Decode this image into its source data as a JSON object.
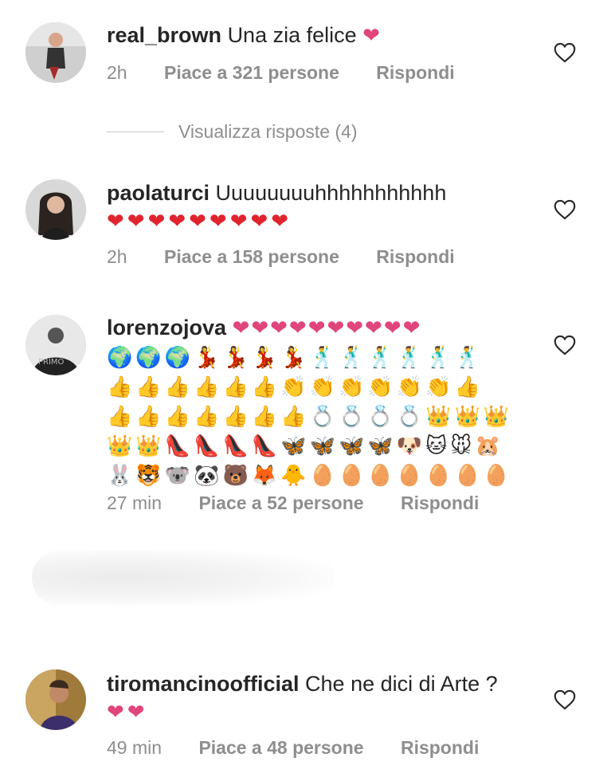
{
  "comments": [
    {
      "username": "real_brown",
      "text": "Una zia felice",
      "inline_emoji": "❤",
      "time": "2h",
      "likes": "Piace a 321 persone",
      "reply": "Rispondi"
    },
    {
      "username": "paolaturci",
      "text": "Uuuuuuuuhhhhhhhhhhh",
      "emoji_line": "❤❤❤❤❤❤❤❤❤",
      "time": "2h",
      "likes": "Piace a 158 persone",
      "reply": "Rispondi"
    },
    {
      "username": "lorenzojova",
      "inline_emoji": "❤❤❤❤❤❤❤❤❤❤",
      "emoji_lines": [
        "🌍🌍🌍💃💃💃💃🕺🕺🕺🕺🕺🕺",
        "👍👍👍👍👍👍👏👏👏👏👏👏👍",
        "👍👍👍👍👍👍👍💍💍💍💍👑👑👑",
        "👑👑👠👠👠👠🦋🦋🦋🦋🐶🐱🐭🐹",
        "🐰🐯🐨🐼🐻🦊🐥🥚🥚🥚🥚🥚🥚🥚"
      ],
      "time": "27 min",
      "likes": "Piace a 52 persone",
      "reply": "Rispondi"
    },
    {
      "username": "tiromancinoofficial",
      "text": "Che ne dici di Arte ?",
      "emoji_line": "❤❤",
      "time": "49 min",
      "likes": "Piace a 48 persone",
      "reply": "Rispondi"
    }
  ],
  "view_replies": "Visualizza risposte (4)",
  "icons": {
    "like": "heart-outline-icon"
  },
  "colors": {
    "meta_gray": "#8e8e8e",
    "text": "#262626",
    "pink_heart": "#e0457b",
    "red_heart": "#e0242e"
  }
}
